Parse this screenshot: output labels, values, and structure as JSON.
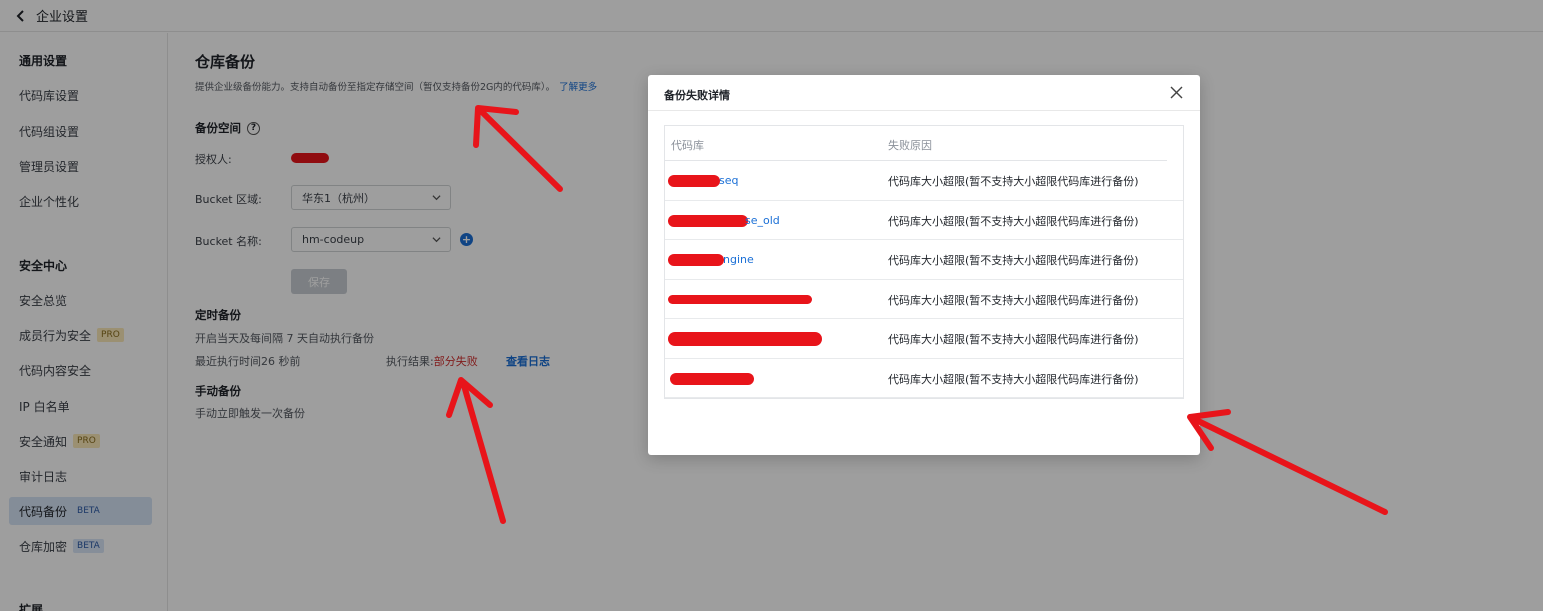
{
  "topbar": {
    "title": "企业设置"
  },
  "sidebar": {
    "group_general": "通用设置",
    "group_security": "安全中心",
    "group_extend": "扩展",
    "items": [
      {
        "label": "代码库设置"
      },
      {
        "label": "代码组设置"
      },
      {
        "label": "管理员设置"
      },
      {
        "label": "企业个性化"
      },
      {
        "label": "安全总览"
      },
      {
        "label": "成员行为安全",
        "tag": "PRO"
      },
      {
        "label": "代码内容安全"
      },
      {
        "label": "IP 白名单"
      },
      {
        "label": "安全通知",
        "tag": "PRO"
      },
      {
        "label": "审计日志"
      },
      {
        "label": "代码备份",
        "tag": "BETA",
        "active": true
      },
      {
        "label": "仓库加密",
        "tag": "BETA"
      }
    ]
  },
  "main": {
    "title": "仓库备份",
    "desc": "提供企业级备份能力。支持自动备份至指定存储空间（暂仅支持备份2G内的代码库）。",
    "learn_more": "了解更多",
    "backup_space": "备份空间",
    "authorizer_label": "授权人:",
    "bucket_region_label": "Bucket 区域:",
    "bucket_region_value": "华东1（杭州）",
    "bucket_name_label": "Bucket 名称:",
    "bucket_name_value": "hm-codeup",
    "save_label": "保存",
    "scheduled_title": "定时备份",
    "scheduled_desc": "开启当天及每间隔 7 天自动执行备份",
    "last_run": "最近执行时间26 秒前",
    "result_label": "执行结果:",
    "result_value": "部分失败",
    "view_log": "查看日志",
    "manual_title": "手动备份",
    "manual_desc": "手动立即触发一次备份"
  },
  "modal": {
    "title": "备份失败详情",
    "col_repo": "代码库",
    "col_reason": "失败原因",
    "rows": [
      {
        "repo": "seq",
        "reason": "代码库大小超限(暂不支持大小超限代码库进行备份)"
      },
      {
        "repo": "se_old",
        "reason": "代码库大小超限(暂不支持大小超限代码库进行备份)"
      },
      {
        "repo": "ngine",
        "reason": "代码库大小超限(暂不支持大小超限代码库进行备份)"
      },
      {
        "repo": "",
        "reason": "代码库大小超限(暂不支持大小超限代码库进行备份)"
      },
      {
        "repo": "",
        "reason": "代码库大小超限(暂不支持大小超限代码库进行备份)"
      },
      {
        "repo": "",
        "reason": "代码库大小超限(暂不支持大小超限代码库进行备份)"
      }
    ]
  },
  "colors": {
    "accent": "#1a6fd6",
    "fail": "#d12f2f",
    "annotation": "#e8141a",
    "active_bg": "#d6e4f5"
  }
}
